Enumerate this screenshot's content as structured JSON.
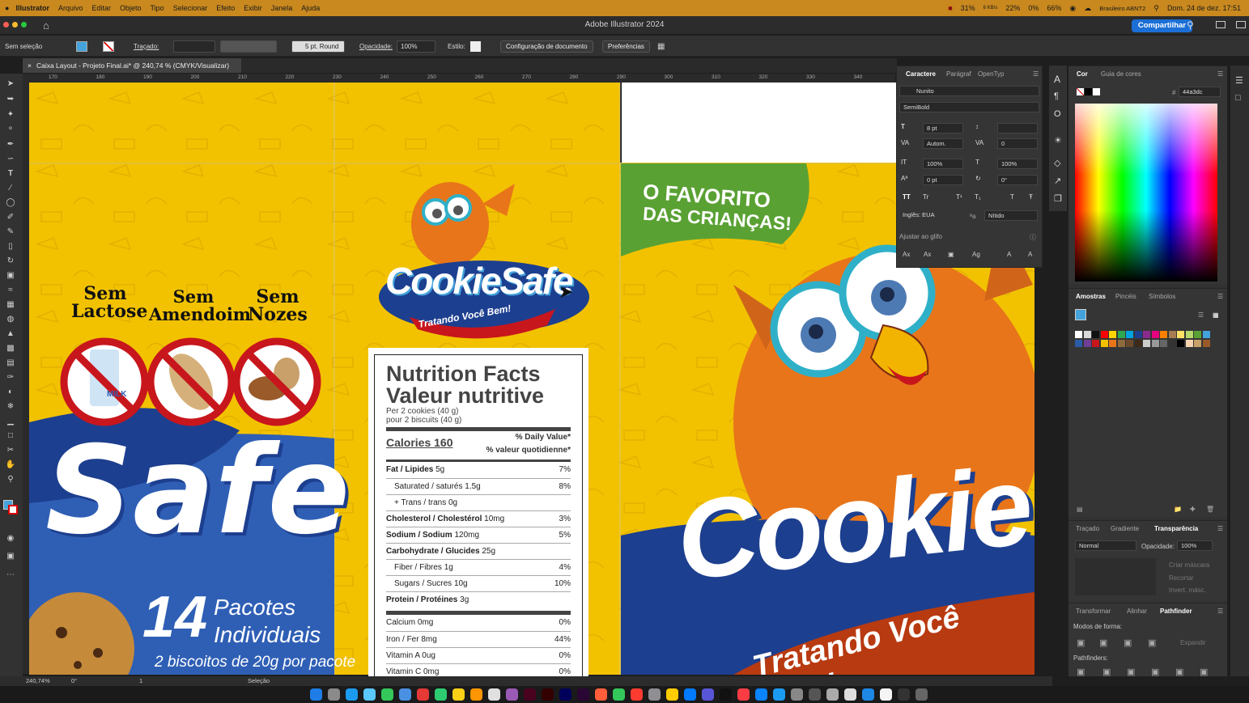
{
  "menubar": {
    "apple": "",
    "app": "Illustrator",
    "items": [
      "Arquivo",
      "Editar",
      "Objeto",
      "Tipo",
      "Selecionar",
      "Efeito",
      "Exibir",
      "Janela",
      "Ajuda"
    ],
    "status": [
      "31%",
      "6 KB/s",
      "22%",
      "0%",
      "66%",
      "Brasileiro ABNT2",
      "Dom. 24 de dez.  17:51"
    ],
    "status2": [
      "25 KB/s"
    ]
  },
  "window": {
    "title": "Adobe Illustrator 2024",
    "share": "Compartilhar"
  },
  "control": {
    "selection": "Sem seleção",
    "stroke_label": "Traçado:",
    "stroke_style": "5 pt. Round",
    "opacity_label": "Opacidade:",
    "opacity": "100%",
    "style_label": "Estilo:",
    "doc_setup": "Configuração de documento",
    "prefs": "Preferências"
  },
  "doc": {
    "tab": "Caixa Layout - Projeto Final.ai* @ 240,74 % (CMYK/Visualizar)",
    "close": "×"
  },
  "ruler": [
    "170",
    "180",
    "190",
    "200",
    "210",
    "220",
    "230",
    "240",
    "250",
    "260",
    "270",
    "280",
    "290",
    "300",
    "310",
    "320",
    "330",
    "340"
  ],
  "status": {
    "zoom": "240,74%",
    "angle": "0°",
    "page": "1",
    "tool": "Seleção"
  },
  "char": {
    "tabs": [
      "Caractere",
      "Parágraf",
      "OpenTyp"
    ],
    "font": "Nunito",
    "weight": "SemiBold",
    "size": "8 pt",
    "leading": "",
    "kerning": "Autom.",
    "tracking": "0",
    "vscale": "100%",
    "hscale": "100%",
    "baseline": "0 pt",
    "rotate": "0°",
    "lang": "Inglês: EUA",
    "aa_label": "ªa",
    "aa": "Nítido",
    "snap": "Ajustar ao glifo"
  },
  "color": {
    "tabs": [
      "Cor",
      "Guia de cores"
    ],
    "hex": "44a3dc",
    "hex_label": "#"
  },
  "swatches": {
    "tabs": [
      "Amostras",
      "Pincéis",
      "Símbolos"
    ]
  },
  "transp": {
    "tabs": [
      "Traçado",
      "Gradiente",
      "Transparência"
    ],
    "mode": "Normal",
    "opacity_label": "Opacidade:",
    "opacity": "100%",
    "mask": "Criar máscara",
    "clip": "Recortar",
    "invert": "Invert. másc."
  },
  "pathfinder": {
    "tabs": [
      "Transformar",
      "Alinhar",
      "Pathfinder"
    ],
    "shape_modes": "Modos de forma:",
    "expand": "Expandir",
    "pathfinders": "Pathfinders:"
  },
  "art": {
    "badges": [
      {
        "l1": "Sem",
        "l2": "Lactose"
      },
      {
        "l1": "Sem",
        "l2": "Amendoim"
      },
      {
        "l1": "Sem",
        "l2": "Nozes"
      }
    ],
    "milk": "MILK",
    "safe": "Safe",
    "pacotes": "14",
    "pacotes_l1": "Pacotes",
    "pacotes_l2": "Individuais",
    "biscoitos": "2 biscoitos de 20g por pacote",
    "logo1": "CookieSafe",
    "logo_tag": "Tratando Você Bem!",
    "favorito1": "O FAVORITO",
    "favorito2": "DAS CRIANÇAS!",
    "cookie": "Cookie",
    "tag_big": "Tratando Você Bem!"
  },
  "nutrition": {
    "title_en": "Nutrition Facts",
    "title_fr": "Valeur nutritive",
    "per1": "Per 2 cookies (40 g)",
    "per2": "pour 2 biscuits (40 g)",
    "calories": "Calories 160",
    "dv1": "% Daily Value*",
    "dv2": "% valeur quotidienne*",
    "rows": [
      {
        "label": "Fat / Lipides",
        "amount": "5g",
        "dv": "7%",
        "bold": true,
        "indent": false
      },
      {
        "label": "Saturated / saturés",
        "amount": "1.5g",
        "dv": "8%",
        "bold": false,
        "indent": true
      },
      {
        "label": "+ Trans / trans",
        "amount": "0g",
        "dv": "",
        "bold": false,
        "indent": true
      },
      {
        "label": "Cholesterol / Cholestérol",
        "amount": "10mg",
        "dv": "3%",
        "bold": true,
        "indent": false
      },
      {
        "label": "Sodium / Sodium",
        "amount": "120mg",
        "dv": "5%",
        "bold": true,
        "indent": false
      },
      {
        "label": "Carbohydrate / Glucides",
        "amount": "25g",
        "dv": "",
        "bold": true,
        "indent": false
      },
      {
        "label": "Fiber / Fibres",
        "amount": "1g",
        "dv": "4%",
        "bold": false,
        "indent": true
      },
      {
        "label": "Sugars / Sucres",
        "amount": "10g",
        "dv": "10%",
        "bold": false,
        "indent": true
      },
      {
        "label": "Protein / Protéines",
        "amount": "3g",
        "dv": "",
        "bold": true,
        "indent": false
      }
    ],
    "vitamins": [
      {
        "label": "Calcium",
        "amount": "0mg",
        "dv": "0%"
      },
      {
        "label": "Iron / Fer",
        "amount": "8mg",
        "dv": "44%"
      },
      {
        "label": "Vitamin A",
        "amount": "0ug",
        "dv": "0%"
      },
      {
        "label": "Vitamin C",
        "amount": "0mg",
        "dv": "0%"
      }
    ]
  },
  "colors": {
    "accent": "#1b6fd6",
    "artboard": "#f2c200",
    "green": "#5aa134",
    "red": "#c8161d",
    "blue": "#1d3f8f",
    "orange": "#e8751a"
  }
}
